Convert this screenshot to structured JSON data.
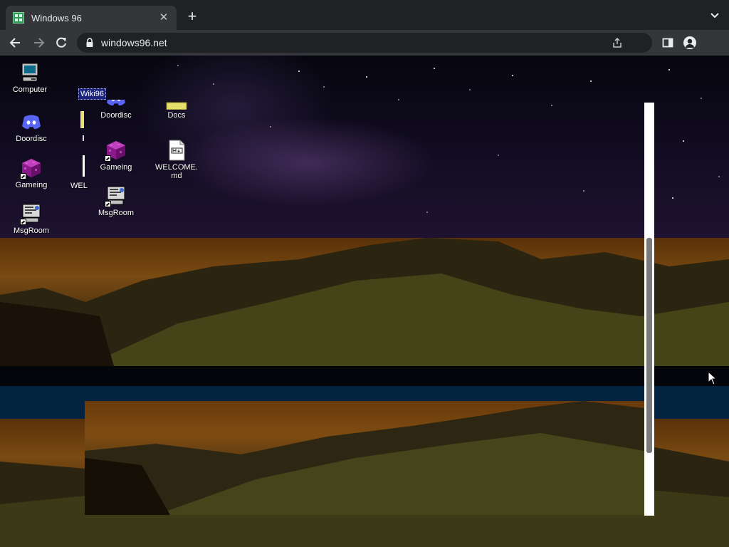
{
  "browser": {
    "tab": {
      "title": "Windows 96",
      "close_label": "✕",
      "favicon": "windows96-logo-icon"
    },
    "new_tab_label": "+",
    "url": "windows96.net",
    "icons": [
      "back-icon",
      "forward-icon",
      "reload-icon",
      "lock-icon",
      "share-icon",
      "side-panel-icon",
      "profile-icon",
      "tab-menu-icon"
    ]
  },
  "desktop": {
    "selected_label": "Wiki96",
    "partial_label": "WEL",
    "left_column": [
      {
        "label": "Computer",
        "icon": "computer-icon"
      },
      {
        "label": "Doordisc",
        "icon": "discord-icon"
      },
      {
        "label": "Gameing",
        "icon": "game-cube-icon"
      },
      {
        "label": "MsgRoom",
        "icon": "msgroom-icon"
      }
    ],
    "folder_window": [
      {
        "label": "Doordisc",
        "icon": "discord-icon"
      },
      {
        "label": "Docs",
        "icon": "folder-icon"
      },
      {
        "label": "Gameing",
        "icon": "game-cube-icon"
      },
      {
        "label": "WELCOME.md",
        "icon": "markdown-file-icon"
      },
      {
        "label": "MsgRoom",
        "icon": "msgroom-icon"
      }
    ]
  },
  "colors": {
    "chrome_dark": "#202124",
    "chrome_toolbar": "#35363a",
    "selection": "#1a237e",
    "discord": "#5865f2"
  }
}
